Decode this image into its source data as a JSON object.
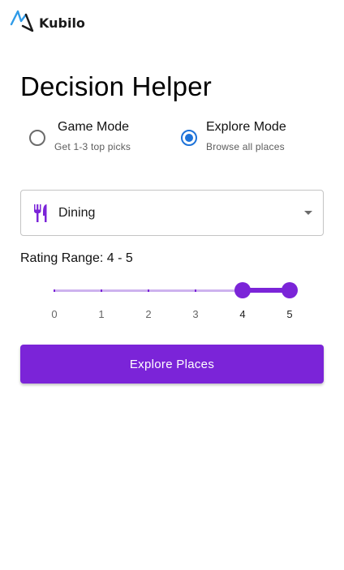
{
  "brand": {
    "name": "Kubilo"
  },
  "title": "Decision Helper",
  "modes": [
    {
      "label": "Game Mode",
      "sub": "Get 1-3 top picks",
      "selected": false
    },
    {
      "label": "Explore Mode",
      "sub": "Browse all places",
      "selected": true
    }
  ],
  "category_select": {
    "value": "Dining",
    "icon": "fork-knife-icon"
  },
  "rating": {
    "label": "Rating Range: 4 - 5",
    "min": 0,
    "max": 5,
    "range": [
      4,
      5
    ],
    "ticks": [
      "0",
      "1",
      "2",
      "3",
      "4",
      "5"
    ]
  },
  "action": {
    "label": "Explore Places"
  },
  "colors": {
    "accent": "#7b24d8",
    "accent_light": "#cdb2ee",
    "radio_selected": "#1e73d9",
    "logo_blue": "#2f9be8"
  }
}
